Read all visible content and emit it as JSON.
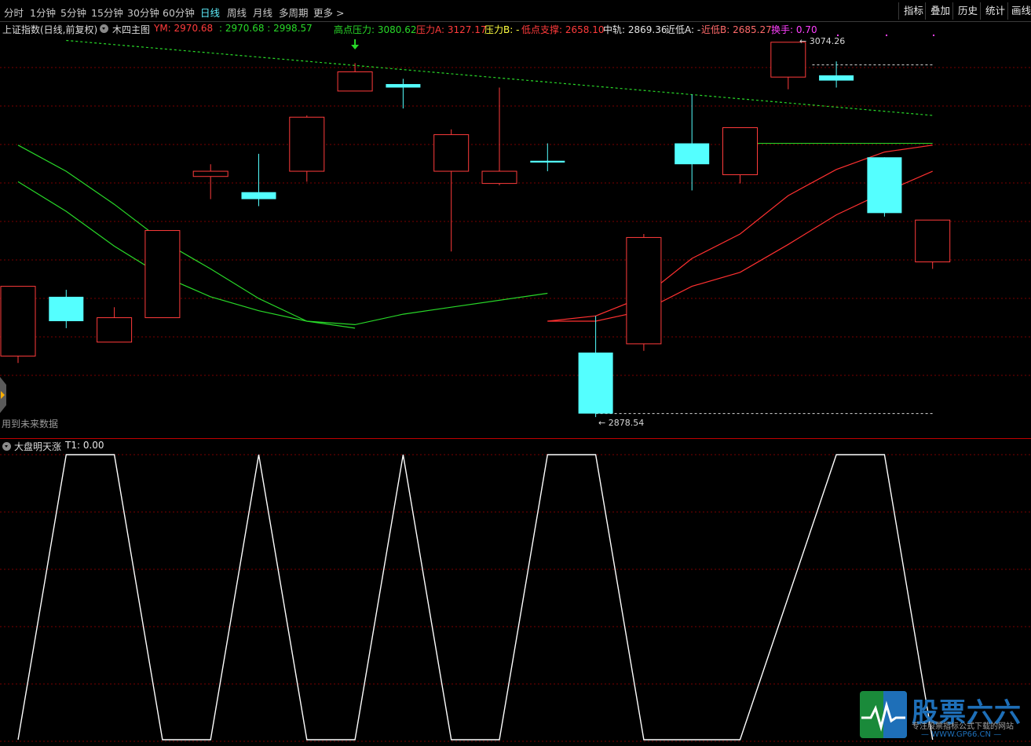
{
  "toolbar": {
    "tabs": [
      "分时",
      "1分钟",
      "5分钟",
      "15分钟",
      "30分钟",
      "60分钟",
      "日线",
      "周线",
      "月线",
      "多周期",
      "更多 >"
    ],
    "active_tab": "日线",
    "right_buttons": [
      "指标",
      "叠加",
      "历史",
      "统计",
      "画线"
    ]
  },
  "main_legend": {
    "index_name": "上证指数(日线,前复权)",
    "indicator_name": "木四主图",
    "ym_label": "YM: 2970.68",
    "ym_values": ": 2970.68 : 2998.57",
    "high_pressure": "高点压力: 3080.62",
    "pressure_a": "压力A: 3127.17",
    "pressure_b": "压力B: -",
    "low_support": "低点支撑: 2658.10",
    "mid_rail": "中轨: 2869.36",
    "near_low_a": "近低A: -",
    "near_low_b": "近低B: 2685.27",
    "turnover": "换手: 0.70",
    "future_data_note": "用到未来数据"
  },
  "annotations": {
    "high_label": "3074.26",
    "low_label": "2878.54"
  },
  "sub_indicator": {
    "name": "大盘明天涨",
    "value": "T1: 0.00"
  },
  "watermark": {
    "title": "股票六六",
    "subtitle": "专注股票指标公式下载的网站",
    "url": "— WWW.GP66.CN —"
  },
  "colors": {
    "up": "#ff3b3b",
    "down": "#54ffff",
    "ma": "#28d828",
    "trend": "#28d828",
    "pressure": "#ff3030",
    "grid": "#7a0000"
  },
  "chart_data": [
    {
      "type": "candlestick",
      "candles": [
        {
          "open": 2912,
          "close": 2952,
          "high": 2952,
          "low": 2908
        },
        {
          "open": 2946,
          "close": 2932,
          "high": 2950,
          "low": 2928
        },
        {
          "open": 2920,
          "close": 2934,
          "high": 2940,
          "low": 2920
        },
        {
          "open": 2934,
          "close": 2984,
          "high": 2984,
          "low": 2934
        },
        {
          "open": 3015,
          "close": 3018,
          "high": 3022,
          "low": 3002
        },
        {
          "open": 3006,
          "close": 3002,
          "high": 3028,
          "low": 2998
        },
        {
          "open": 3018,
          "close": 3049,
          "high": 3050,
          "low": 3012
        },
        {
          "open": 3064,
          "close": 3075,
          "high": 3080,
          "low": 3064
        },
        {
          "open": 3068,
          "close": 3066,
          "high": 3071,
          "low": 3054
        },
        {
          "open": 3018,
          "close": 3039,
          "high": 3042,
          "low": 2972
        },
        {
          "open": 3011,
          "close": 3018,
          "high": 3066,
          "low": 3010
        },
        {
          "open": 3024,
          "close": 3023,
          "high": 3034,
          "low": 3018
        },
        {
          "open": 2914,
          "close": 2879,
          "high": 2935,
          "low": 2877
        },
        {
          "open": 2919,
          "close": 2980,
          "high": 2982,
          "low": 2915
        },
        {
          "open": 3034,
          "close": 3022,
          "high": 3062,
          "low": 3007
        },
        {
          "open": 3016,
          "close": 3043,
          "high": 3043,
          "low": 3011
        },
        {
          "open": 3072,
          "close": 3092,
          "high": 3092,
          "low": 3065
        },
        {
          "open": 3073,
          "close": 3070,
          "high": 3081,
          "low": 3066
        },
        {
          "open": 3026,
          "close": 2994,
          "high": 3026,
          "low": 2992
        },
        {
          "open": 2966,
          "close": 2990,
          "high": 2990,
          "low": 2962
        }
      ],
      "ma_green_1": [
        [
          0,
          3033
        ],
        [
          2,
          3018
        ],
        [
          4,
          2999
        ],
        [
          6,
          2978
        ],
        [
          8,
          2962
        ],
        [
          10,
          2945
        ],
        [
          12,
          2932
        ],
        [
          14,
          2928
        ]
      ],
      "ma_green_2": [
        [
          0,
          3012
        ],
        [
          2,
          2995
        ],
        [
          4,
          2975
        ],
        [
          6,
          2958
        ],
        [
          8,
          2946
        ],
        [
          10,
          2938
        ],
        [
          12,
          2932
        ],
        [
          14,
          2930
        ],
        [
          16,
          2936
        ],
        [
          18,
          2940
        ],
        [
          22,
          2948
        ]
      ],
      "ma_red_1": [
        [
          22,
          2932
        ],
        [
          24,
          2935
        ],
        [
          26,
          2946
        ],
        [
          28,
          2968
        ],
        [
          30,
          2982
        ],
        [
          32,
          3004
        ],
        [
          34,
          3019
        ],
        [
          36,
          3029
        ],
        [
          38,
          3033
        ]
      ],
      "ma_red_2": [
        [
          22,
          2932
        ],
        [
          24,
          2932
        ],
        [
          26,
          2938
        ],
        [
          28,
          2952
        ],
        [
          30,
          2960
        ],
        [
          32,
          2976
        ],
        [
          34,
          2993
        ],
        [
          36,
          3006
        ],
        [
          38,
          3018
        ]
      ],
      "trend_line": [
        [
          2,
          3093
        ],
        [
          38,
          3050
        ]
      ],
      "near_low_b_line": {
        "from": 30,
        "to": 38,
        "value": 3034
      },
      "high_level": {
        "from": 33,
        "to": 38,
        "value": 3079
      },
      "low_level": {
        "from": 24,
        "to": 38,
        "value": 2879
      },
      "high_marker": {
        "x": 14,
        "value": 3080.62
      },
      "ylim": [
        2873,
        3100
      ]
    },
    {
      "type": "line",
      "name": "大盘明天涨",
      "points": [
        [
          0,
          0
        ],
        [
          2,
          1
        ],
        [
          4,
          1
        ],
        [
          6,
          0
        ],
        [
          8,
          0
        ],
        [
          10,
          1
        ],
        [
          12,
          0
        ],
        [
          14,
          0
        ],
        [
          16,
          1
        ],
        [
          18,
          0
        ],
        [
          20,
          0
        ],
        [
          22,
          1
        ],
        [
          24,
          1
        ],
        [
          26,
          0
        ],
        [
          28,
          0
        ],
        [
          30,
          0
        ],
        [
          34,
          1
        ],
        [
          36,
          1
        ],
        [
          38,
          0
        ]
      ],
      "ylim": [
        0,
        1
      ]
    }
  ]
}
